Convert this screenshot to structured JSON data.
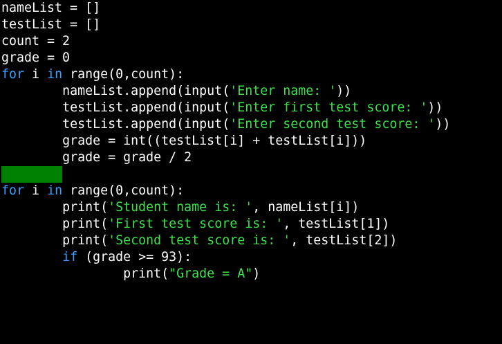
{
  "colors": {
    "background": "#000000",
    "text": "#ffffff",
    "keyword": "#3aa0ff",
    "string": "#3ce24a",
    "selection_block": "#008000"
  },
  "code": {
    "l1": {
      "text": "nameList = []"
    },
    "l2": {
      "text": "testList = []"
    },
    "l3": {
      "text": "count = 2"
    },
    "l4": {
      "text": "grade = 0"
    },
    "l5": {
      "kw": "for",
      "mid1": " i ",
      "kw2": "in",
      "rest": " range(0,count):"
    },
    "l6": {
      "indent": "        ",
      "pre": "nameList.append(input(",
      "str": "'Enter name: '",
      "post": "))"
    },
    "l7": {
      "indent": "        ",
      "pre": "testList.append(input(",
      "str": "'Enter first test score: '",
      "post": "))"
    },
    "l8": {
      "indent": "        ",
      "pre": "testList.append(input(",
      "str": "'Enter second test score: '",
      "post": "))"
    },
    "l9": {
      "indent": "        ",
      "text": "grade = int((testList[i] + testList[i]))"
    },
    "l10": {
      "indent": "        ",
      "text": "grade = grade / 2"
    },
    "l12": {
      "kw": "for",
      "mid1": " i ",
      "kw2": "in",
      "rest": " range(0,count):"
    },
    "l13": {
      "indent": "        ",
      "pre": "print(",
      "str": "'Student name is: '",
      "post": ", nameList[i])"
    },
    "l14": {
      "indent": "        ",
      "pre": "print(",
      "str": "'First test score is: '",
      "post": ", testList[1])"
    },
    "l15": {
      "indent": "        ",
      "pre": "print(",
      "str": "'Second test score is: '",
      "post": ", testList[2])"
    },
    "l16": {
      "indent": "        ",
      "kw": "if",
      "rest": " (grade >= 93):"
    },
    "l17": {
      "indent": "                ",
      "pre": "print(",
      "str": "\"Grade = A\"",
      "post": ")"
    }
  }
}
